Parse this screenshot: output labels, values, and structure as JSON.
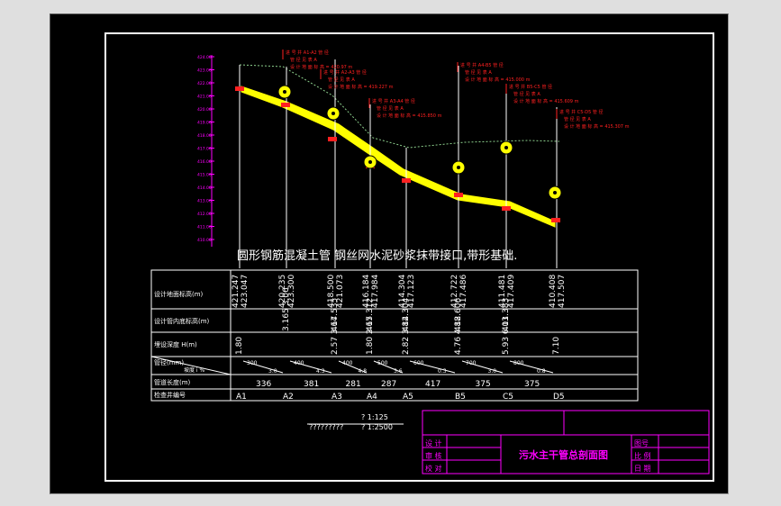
{
  "title": "圆形钢筋混凝土管  钢丝网水泥砂浆抹带接口,带形基础.",
  "elevation_ticks": [
    "424.00",
    "423.00",
    "422.00",
    "421.00",
    "420.00",
    "419.00",
    "418.00",
    "417.00",
    "416.00",
    "415.00",
    "414.00",
    "413.00",
    "412.00",
    "411.00",
    "410.00"
  ],
  "table": {
    "row_labels": [
      "设计地面标高(m)",
      "设计管内底标高(m)",
      "埋设深度 H(m)",
      "管径(mm)",
      "管道长度(m)",
      "检查井编号"
    ],
    "gradient_label": "坡度 i %",
    "columns": [
      {
        "ground": "421.247",
        "ground_b": "423.047",
        "invert": "",
        "depth": "1.80",
        "manhole": "A1"
      },
      {
        "ground": "420.235",
        "ground_b": "423.300",
        "invert": "3.165  3.06",
        "invert_b": "420.140",
        "depth": "",
        "manhole": "A2"
      },
      {
        "ground": "418.500",
        "ground_b": "421.073",
        "invert": "417.535",
        "depth": "2.57  3.64",
        "manhole": "A3"
      },
      {
        "ground": "416.184",
        "ground_b": "417.984",
        "invert": "415.312",
        "depth": "1.80  2.67",
        "manhole": "A4"
      },
      {
        "ground": "414.304",
        "ground_b": "417.123",
        "invert": "414.304",
        "depth": "2.82  3.82",
        "manhole": "A5"
      },
      {
        "ground": "412.722",
        "ground_b": "417.486",
        "invert": "412.606",
        "depth": "4.76  4.88",
        "manhole": "B5"
      },
      {
        "ground": "411.481",
        "ground_b": "417.409",
        "invert": "411.383",
        "depth": "5.93  6.03",
        "manhole": "C5"
      },
      {
        "ground": "410.408",
        "ground_b": "417.507",
        "invert": "",
        "depth": "7.10",
        "manhole": "D5"
      }
    ],
    "segments": [
      {
        "dia": "300",
        "slope": "3.0",
        "length": "336"
      },
      {
        "dia": "400",
        "slope": "4.3",
        "length": "381"
      },
      {
        "dia": "400",
        "slope": "4.8",
        "length": "281"
      },
      {
        "dia": "500",
        "slope": "3.6",
        "length": "287"
      },
      {
        "dia": "600",
        "slope": "0.3",
        "length": "417"
      },
      {
        "dia": "700",
        "slope": "3.0",
        "length": "375"
      },
      {
        "dia": "800",
        "slope": "0.8",
        "length": "375"
      }
    ]
  },
  "annotations": [
    {
      "l1": "进 号 井 A1-A2 管 径",
      "l2": "管 径 见 表 A",
      "l3": "设 计 地 面 标 高 = 420.97 m"
    },
    {
      "l1": "进 号 井 A2-A3 管 径",
      "l2": "管 径 见 表 A",
      "l3": "设 计 地 面 标 高 = 419.227 m"
    },
    {
      "l1": "进 号 井 A3-A4 管 径",
      "l2": "管 径 见 表 A",
      "l3": "设 计 地 面 标 高 = 415.850 m"
    },
    {
      "l1": "进 号 井 A4-B5 管 径",
      "l2": "管 径 见 表 A",
      "l3": "设 计 地 面 标 高 = 415.000 m"
    },
    {
      "l1": "进 号 井 B5-C5 管 径",
      "l2": "管 径 见 表 A",
      "l3": "设 计 地 面 标 高 = 415.609 m"
    },
    {
      "l1": "进 号 井 C5-D5 管 径",
      "l2": "管 径 见 表 A",
      "l3": "设 计 地 面 标 高 = 415.307 m"
    }
  ],
  "scale_note": {
    "left": "?????????",
    "r1": "? 1:125",
    "r2": "? 1:2500"
  },
  "title_block": {
    "drawing_title": "污水主干管总剖面图",
    "left_labels": [
      "设 计",
      "审 核",
      "校 对"
    ],
    "right_top": "图号",
    "right_labels": [
      "比 例",
      "日 期"
    ]
  }
}
